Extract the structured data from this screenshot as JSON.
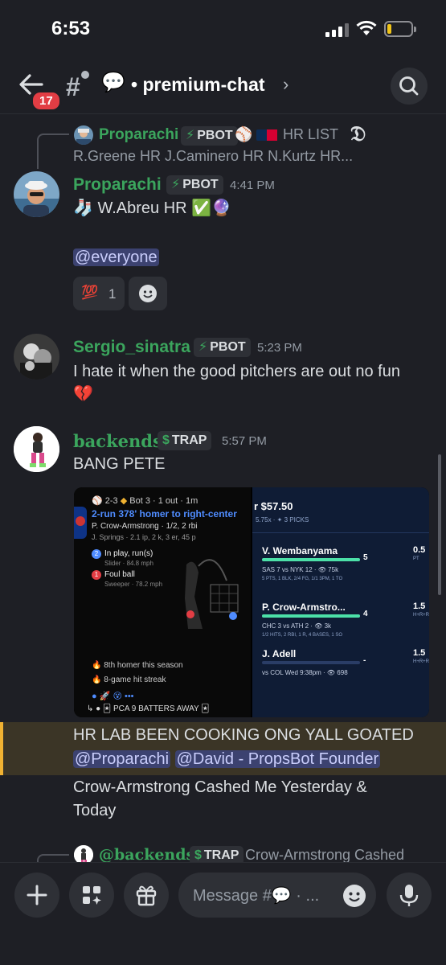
{
  "status_bar": {
    "time": "6:53"
  },
  "header": {
    "unread_count": "17",
    "channel_emoji": "💬",
    "channel_name": "• premium-chat",
    "chevron": "›"
  },
  "reply1": {
    "author": "Proparachi",
    "tag": "PBOT",
    "line1_rest": "HR LIST",
    "line2": "R.Greene HR  J.Caminero HR  N.Kurtz HR..."
  },
  "msg1": {
    "author": "Proparachi",
    "tag": "PBOT",
    "timestamp": "4:41 PM",
    "text": "W.Abreu HR ✅🔮",
    "mention": "@everyone",
    "reaction_emoji": "💯",
    "reaction_count": "1"
  },
  "msg2": {
    "author": "Sergio_sinatra",
    "tag": "PBOT",
    "timestamp": "5:23 PM",
    "text": "I hate it when the good pitchers are out no fun",
    "text2": "💔"
  },
  "msg3": {
    "author": "backends",
    "tag": "TRAP",
    "timestamp": "5:57 PM",
    "text": "BANG PETE",
    "embed": {
      "score": "2-3",
      "inning": "Bot 3 · 1 out · 1m",
      "headline": "2-run 378' homer to right-center",
      "batter": "P. Crow-Armstrong · 1/2, 2 rbi",
      "pitcher": "J. Springs · 2.1 ip, 2 k, 3 er, 45 p",
      "play1": "In play, run(s)",
      "play1_sub": "Slider · 84.8 mph",
      "play2": "Foul ball",
      "play2_sub": "Sweeper · 78.2 mph",
      "note1": "8th homer this season",
      "note2": "8-game hit streak",
      "footer": "PCA 9 BATTERS AWAY",
      "bet_amount": "$57.50",
      "bet_meta": "5.75x · ✦ 3 PICKS",
      "picks": [
        {
          "name": "V. Wembanyama",
          "value": "5",
          "line": "0.5",
          "unit": "PT",
          "game": "SAS 7 vs NYK 12 · 👁 75k",
          "stats": "5 PTS, 1 BLK, 2/4 FG, 1/1 3PM, 1 TO",
          "progress": 1.0
        },
        {
          "name": "P. Crow-Armstro...",
          "value": "4",
          "line": "1.5",
          "unit": "H+R+RB",
          "game": "CHC 3 vs ATH 2 · 👁 3k",
          "stats": "1/2 HITS, 2 RBI, 1 R, 4 BASES, 1 SO",
          "progress": 1.0
        },
        {
          "name": "J. Adell",
          "value": "-",
          "line": "1.5",
          "unit": "H+R+RB",
          "game": "vs COL Wed 9:38pm · 👁 698",
          "stats": "",
          "progress": 0.0
        }
      ]
    }
  },
  "msg4": {
    "line1": "HR LAB BEEN COOKING ONG YALL GOATED",
    "mention1": "@Proparachi",
    "mention2": "@David - PropsBot Founder",
    "line3": "Crow-Armstrong Cashed Me Yesterday &",
    "line4": "Today"
  },
  "reply2": {
    "author": "@backends",
    "tag": "TRAP",
    "text": "Crow-Armstrong Cashed"
  },
  "composer": {
    "placeholder": "Message #💬 · ..."
  }
}
